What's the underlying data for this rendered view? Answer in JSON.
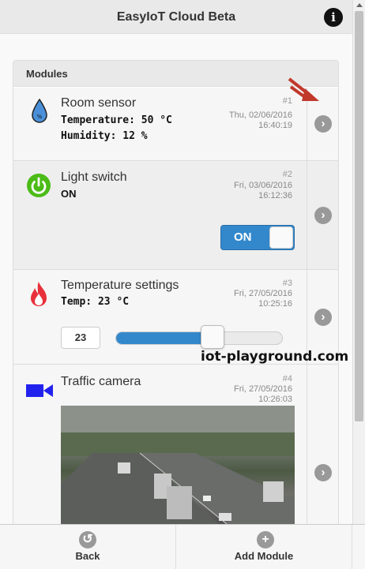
{
  "header": {
    "title": "EasyIoT Cloud Beta",
    "info_icon": "info-icon"
  },
  "panel": {
    "title": "Modules"
  },
  "modules": [
    {
      "name": "Room sensor",
      "icon": "water-drop-icon",
      "number": "#1",
      "date": "Thu, 02/06/2016",
      "time": "16:40:19",
      "lines": [
        "Temperature: 50 °C",
        "Humidity: 12 %"
      ]
    },
    {
      "name": "Light switch",
      "icon": "power-icon",
      "number": "#2",
      "date": "Fri, 03/06/2016",
      "time": "16:12:36",
      "state": "ON",
      "toggle_label": "ON"
    },
    {
      "name": "Temperature settings",
      "icon": "flame-icon",
      "number": "#3",
      "date": "Fri, 27/05/2016",
      "time": "10:25:16",
      "value_line": "Temp: 23 °C",
      "input_value": "23",
      "slider_fraction": 0.58
    },
    {
      "name": "Traffic camera",
      "icon": "video-camera-icon",
      "number": "#4",
      "date": "Fri, 27/05/2016",
      "time": "10:26:03"
    }
  ],
  "watermark": "iot-playground.com",
  "footer": {
    "back_label": "Back",
    "add_label": "Add Module"
  },
  "colors": {
    "accent": "#3388cc",
    "power": "#4cbb17",
    "flame": "#e8303a",
    "camera": "#2222ee",
    "drop": "#4a90d9"
  }
}
